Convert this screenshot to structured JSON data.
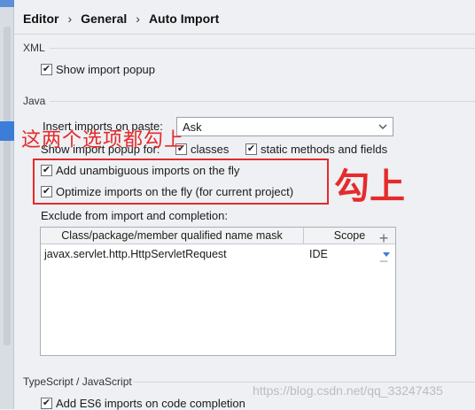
{
  "breadcrumb": {
    "items": [
      "Editor",
      "General",
      "Auto Import"
    ],
    "separator": "›"
  },
  "xml": {
    "section": "XML",
    "show_import_popup": {
      "label": "Show import popup",
      "checked": true
    }
  },
  "java": {
    "section": "Java",
    "insert_imports_label": "Insert imports on paste:",
    "insert_imports_value": "Ask",
    "show_popup_for_label": "Show import popup for:",
    "classes": {
      "label": "classes",
      "checked": true
    },
    "static_methods": {
      "label": "static methods and fields",
      "checked": true
    },
    "add_unambiguous": {
      "label": "Add unambiguous imports on the fly",
      "checked": true
    },
    "optimize_imports": {
      "label": "Optimize imports on the fly (for current project)",
      "checked": true
    },
    "exclude_label": "Exclude from import and completion:",
    "table": {
      "columns": [
        "Class/package/member qualified name mask",
        "Scope"
      ],
      "rows": [
        {
          "mask": "javax.servlet.http.HttpServletRequest",
          "scope": "IDE"
        }
      ]
    },
    "add_button": "+",
    "remove_button": "−"
  },
  "typescript": {
    "section": "TypeScript / JavaScript",
    "add_es6": {
      "label": "Add ES6 imports on code completion",
      "checked": true
    }
  },
  "annotations": {
    "note": "这两个选项都勾上",
    "check": "勾上"
  },
  "watermark": "https://blog.csdn.net/qq_33247435",
  "colors": {
    "annotation": "#e52b2b",
    "accent": "#3b7fd8"
  }
}
